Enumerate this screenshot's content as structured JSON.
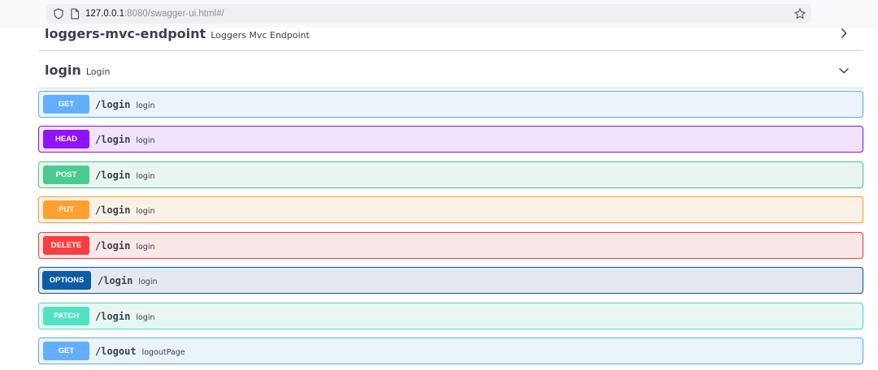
{
  "browser": {
    "url_host": "127.0.0.1",
    "url_rest": ":8080/swagger-ui.html#/",
    "icons": {
      "shield": "shield-icon",
      "page": "page-icon",
      "bookmark": "star-icon"
    }
  },
  "tags": [
    {
      "title": "loggers-mvc-endpoint",
      "description": "Loggers Mvc Endpoint",
      "expanded": false
    },
    {
      "title": "login",
      "description": "Login",
      "expanded": true
    }
  ],
  "operations": [
    {
      "method": "GET",
      "path": "/login",
      "summary": "login",
      "color": "#61affe",
      "bg": "#ebf3fb"
    },
    {
      "method": "HEAD",
      "path": "/login",
      "summary": "login",
      "color": "#9012fe",
      "bg": "#f0e3fb"
    },
    {
      "method": "POST",
      "path": "/login",
      "summary": "login",
      "color": "#49cc90",
      "bg": "#e8f6ef"
    },
    {
      "method": "PUT",
      "path": "/login",
      "summary": "login",
      "color": "#fca130",
      "bg": "#fcf1e6"
    },
    {
      "method": "DELETE",
      "path": "/login",
      "summary": "login",
      "color": "#f93e3e",
      "bg": "#fae7e7"
    },
    {
      "method": "OPTIONS",
      "path": "/login",
      "summary": "login",
      "color": "#0d5aa7",
      "bg": "#e4e9ef"
    },
    {
      "method": "PATCH",
      "path": "/login",
      "summary": "login",
      "color": "#50e3c2",
      "bg": "#e9f7f3"
    },
    {
      "method": "GET",
      "path": "/logout",
      "summary": "logoutPage",
      "color": "#61affe",
      "bg": "#ebf3fb"
    }
  ]
}
